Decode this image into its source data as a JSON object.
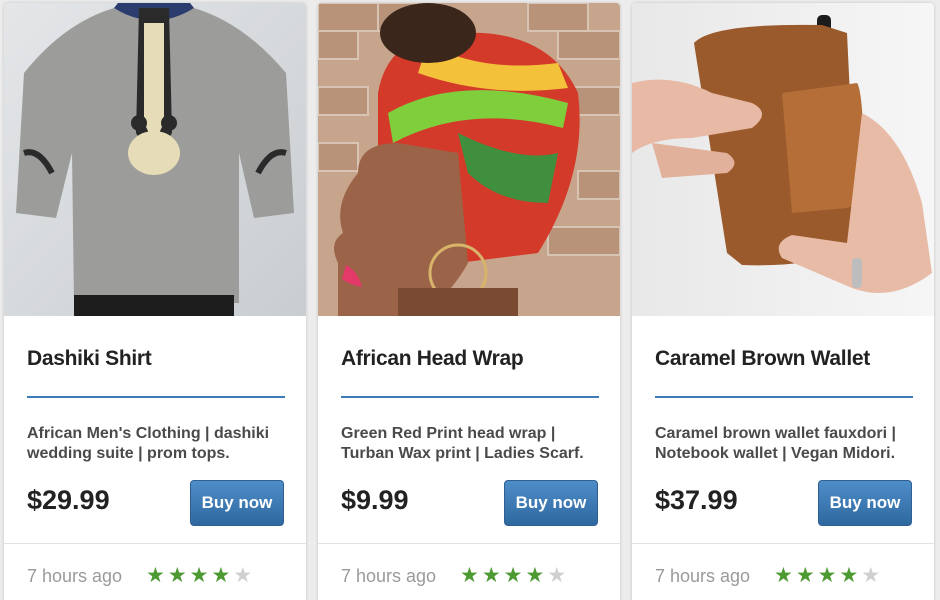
{
  "colors": {
    "accent": "#3a7ab8",
    "button": "#3a78b4",
    "star_filled": "#4d9a33",
    "star_empty": "#d0d0d0"
  },
  "products": [
    {
      "name": "Dashiki Shirt",
      "description": "African Men's Clothing | dashiki wedding suite | prom tops.",
      "price": "$29.99",
      "button_label": "Buy now",
      "posted": "7 hours ago",
      "rating": 4,
      "max_rating": 5,
      "image": "dashiki-shirt-photo"
    },
    {
      "name": "African Head Wrap",
      "description": "Green Red Print head wrap | Turban Wax print | Ladies Scarf.",
      "price": "$9.99",
      "button_label": "Buy now",
      "posted": "7 hours ago",
      "rating": 4,
      "max_rating": 5,
      "image": "head-wrap-photo"
    },
    {
      "name": "Caramel Brown Wallet",
      "description": "Caramel brown wallet fauxdori | Notebook wallet | Vegan Midori.",
      "price": "$37.99",
      "button_label": "Buy now",
      "posted": "7 hours ago",
      "rating": 4,
      "max_rating": 5,
      "image": "brown-wallet-photo"
    }
  ]
}
